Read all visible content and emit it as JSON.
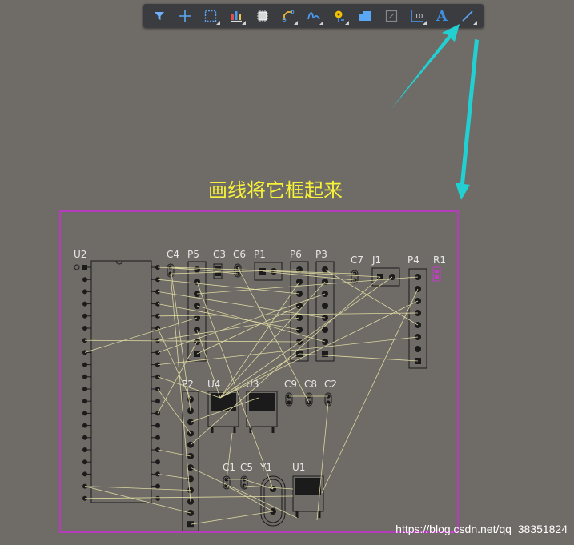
{
  "toolbar": {
    "tools": [
      {
        "name": "filter-tool",
        "icon": "filter-icon"
      },
      {
        "name": "cross-probe-tool",
        "icon": "crosshair-icon"
      },
      {
        "name": "select-tool",
        "icon": "selection-rectangle-icon"
      },
      {
        "name": "align-tool",
        "icon": "align-icon"
      },
      {
        "name": "component-tool",
        "icon": "component-icon"
      },
      {
        "name": "route-tool",
        "icon": "interactive-routing-icon"
      },
      {
        "name": "diff-pair-tool",
        "icon": "differential-pair-icon"
      },
      {
        "name": "via-tool",
        "icon": "place-via-icon"
      },
      {
        "name": "fill-tool",
        "icon": "polygon-fill-icon"
      },
      {
        "name": "region-tool",
        "icon": "region-icon"
      },
      {
        "name": "dimension-tool",
        "icon": "dimension-icon"
      },
      {
        "name": "text-tool",
        "icon": "text-icon",
        "glyph": "A"
      },
      {
        "name": "line-tool",
        "icon": "line-icon"
      }
    ]
  },
  "annotation": {
    "caption": "画线将它框起来",
    "caption_color": "#f7f13a",
    "arrow_color": "#22d0d2"
  },
  "board": {
    "outline_color": "#b53dbb",
    "component_color": "#1b1b1b",
    "ratsnest_color": "#dcd8a0",
    "components": [
      {
        "ref": "U2"
      },
      {
        "ref": "C4"
      },
      {
        "ref": "P5"
      },
      {
        "ref": "C3"
      },
      {
        "ref": "C6"
      },
      {
        "ref": "P1"
      },
      {
        "ref": "P6"
      },
      {
        "ref": "P3"
      },
      {
        "ref": "C7"
      },
      {
        "ref": "J1"
      },
      {
        "ref": "P4"
      },
      {
        "ref": "R1"
      },
      {
        "ref": "P2"
      },
      {
        "ref": "U4"
      },
      {
        "ref": "U3"
      },
      {
        "ref": "C9"
      },
      {
        "ref": "C8"
      },
      {
        "ref": "C2"
      },
      {
        "ref": "C1"
      },
      {
        "ref": "C5"
      },
      {
        "ref": "Y1"
      },
      {
        "ref": "U1"
      }
    ]
  },
  "watermark": "https://blog.csdn.net/qq_38351824"
}
